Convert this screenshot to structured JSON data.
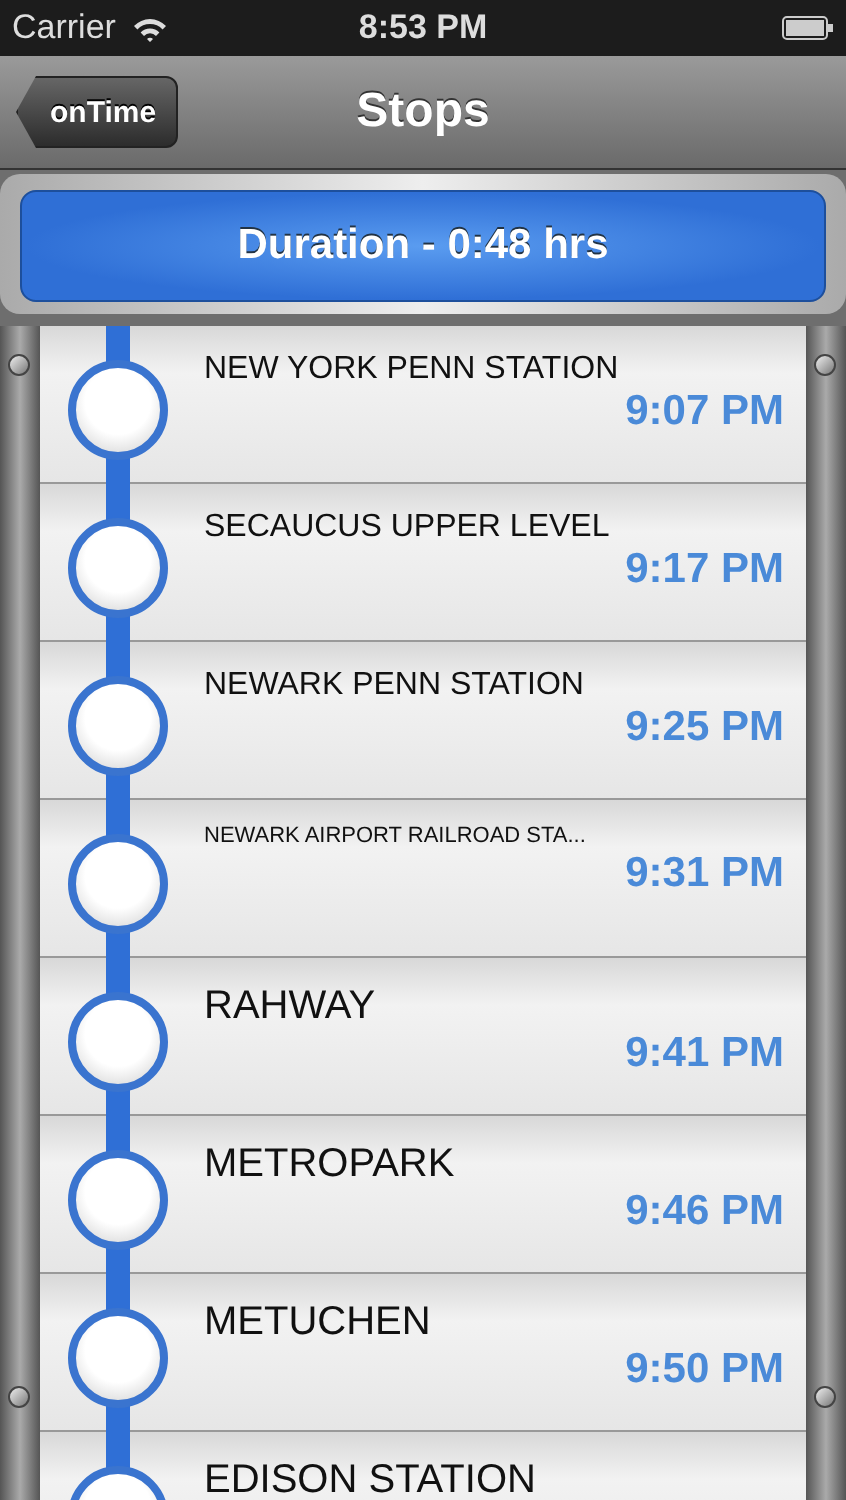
{
  "status_bar": {
    "carrier": "Carrier",
    "time": "8:53 PM"
  },
  "nav_bar": {
    "back": "onTime",
    "title": "Stops"
  },
  "duration": "Duration - 0:48 hrs",
  "stops": [
    {
      "name": "NEW YORK PENN STATION",
      "time": "9:07 PM"
    },
    {
      "name": "SECAUCUS UPPER LEVEL",
      "time": "9:17 PM"
    },
    {
      "name": "NEWARK PENN STATION",
      "time": "9:25 PM"
    },
    {
      "name": "NEWARK AIRPORT RAILROAD STA...",
      "time": "9:31 PM"
    },
    {
      "name": "RAHWAY",
      "time": "9:41 PM"
    },
    {
      "name": "METROPARK",
      "time": "9:46 PM"
    },
    {
      "name": "METUCHEN",
      "time": "9:50 PM"
    },
    {
      "name": "EDISON STATION"
    }
  ]
}
